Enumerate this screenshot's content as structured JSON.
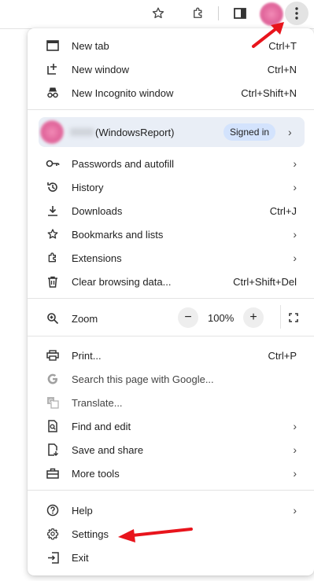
{
  "toolbar": {
    "icons": [
      "star-icon",
      "extensions-icon",
      "side-panel-icon",
      "profile-avatar",
      "kebab-menu-icon"
    ]
  },
  "menu": {
    "group1": [
      {
        "label": "New tab",
        "shortcut": "Ctrl+T",
        "icon": "new-tab-icon"
      },
      {
        "label": "New window",
        "shortcut": "Ctrl+N",
        "icon": "new-window-icon"
      },
      {
        "label": "New Incognito window",
        "shortcut": "Ctrl+Shift+N",
        "icon": "incognito-icon"
      }
    ],
    "profile": {
      "name": "(WindowsReport)",
      "badge": "Signed in",
      "chevron": "›"
    },
    "group2": [
      {
        "label": "Passwords and autofill",
        "chevron": "›",
        "icon": "key-icon"
      },
      {
        "label": "History",
        "chevron": "›",
        "icon": "history-icon"
      },
      {
        "label": "Downloads",
        "shortcut": "Ctrl+J",
        "icon": "download-icon"
      },
      {
        "label": "Bookmarks and lists",
        "chevron": "›",
        "icon": "star-icon"
      },
      {
        "label": "Extensions",
        "chevron": "›",
        "icon": "extensions-icon"
      },
      {
        "label": "Clear browsing data...",
        "shortcut": "Ctrl+Shift+Del",
        "icon": "trash-icon"
      }
    ],
    "zoom": {
      "label": "Zoom",
      "minus": "−",
      "value": "100%",
      "plus": "+"
    },
    "group3": [
      {
        "label": "Print...",
        "shortcut": "Ctrl+P",
        "icon": "printer-icon"
      },
      {
        "label": "Search this page with Google...",
        "icon": "google-icon"
      },
      {
        "label": "Translate...",
        "icon": "translate-icon"
      },
      {
        "label": "Find and edit",
        "chevron": "›",
        "icon": "find-icon"
      },
      {
        "label": "Save and share",
        "chevron": "›",
        "icon": "save-share-icon"
      },
      {
        "label": "More tools",
        "chevron": "›",
        "icon": "toolbox-icon"
      }
    ],
    "group4": [
      {
        "label": "Help",
        "chevron": "›",
        "icon": "help-icon"
      },
      {
        "label": "Settings",
        "icon": "gear-icon"
      },
      {
        "label": "Exit",
        "icon": "exit-icon"
      }
    ]
  },
  "colors": {
    "annotation_arrow": "#e8141c",
    "profile_bg": "#e9eef6",
    "badge_bg": "#d3e3fd"
  }
}
